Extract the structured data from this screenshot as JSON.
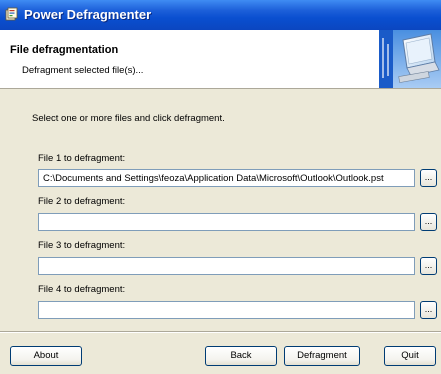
{
  "window": {
    "title": "Power Defragmenter"
  },
  "header": {
    "title": "File defragmentation",
    "subtitle": "Defragment selected file(s)..."
  },
  "main": {
    "instructions": "Select one or more files and click defragment.",
    "files": [
      {
        "label": "File 1 to defragment:",
        "value": "C:\\Documents and Settings\\feoza\\Application Data\\Microsoft\\Outlook\\Outlook.pst",
        "browse_label": "..."
      },
      {
        "label": "File 2 to defragment:",
        "value": "",
        "browse_label": "..."
      },
      {
        "label": "File 3 to defragment:",
        "value": "",
        "browse_label": "..."
      },
      {
        "label": "File 4 to defragment:",
        "value": "",
        "browse_label": "..."
      }
    ]
  },
  "buttons": {
    "about": "About",
    "back": "Back",
    "defragment": "Defragment",
    "quit": "Quit"
  },
  "colors": {
    "titlebar": "#0a4fd0",
    "window_bg": "#ece9d8",
    "header_bg": "#ffffff"
  },
  "icons": {
    "app": "defragmenter-app-icon",
    "header_logo": "computer-logo-icon"
  }
}
